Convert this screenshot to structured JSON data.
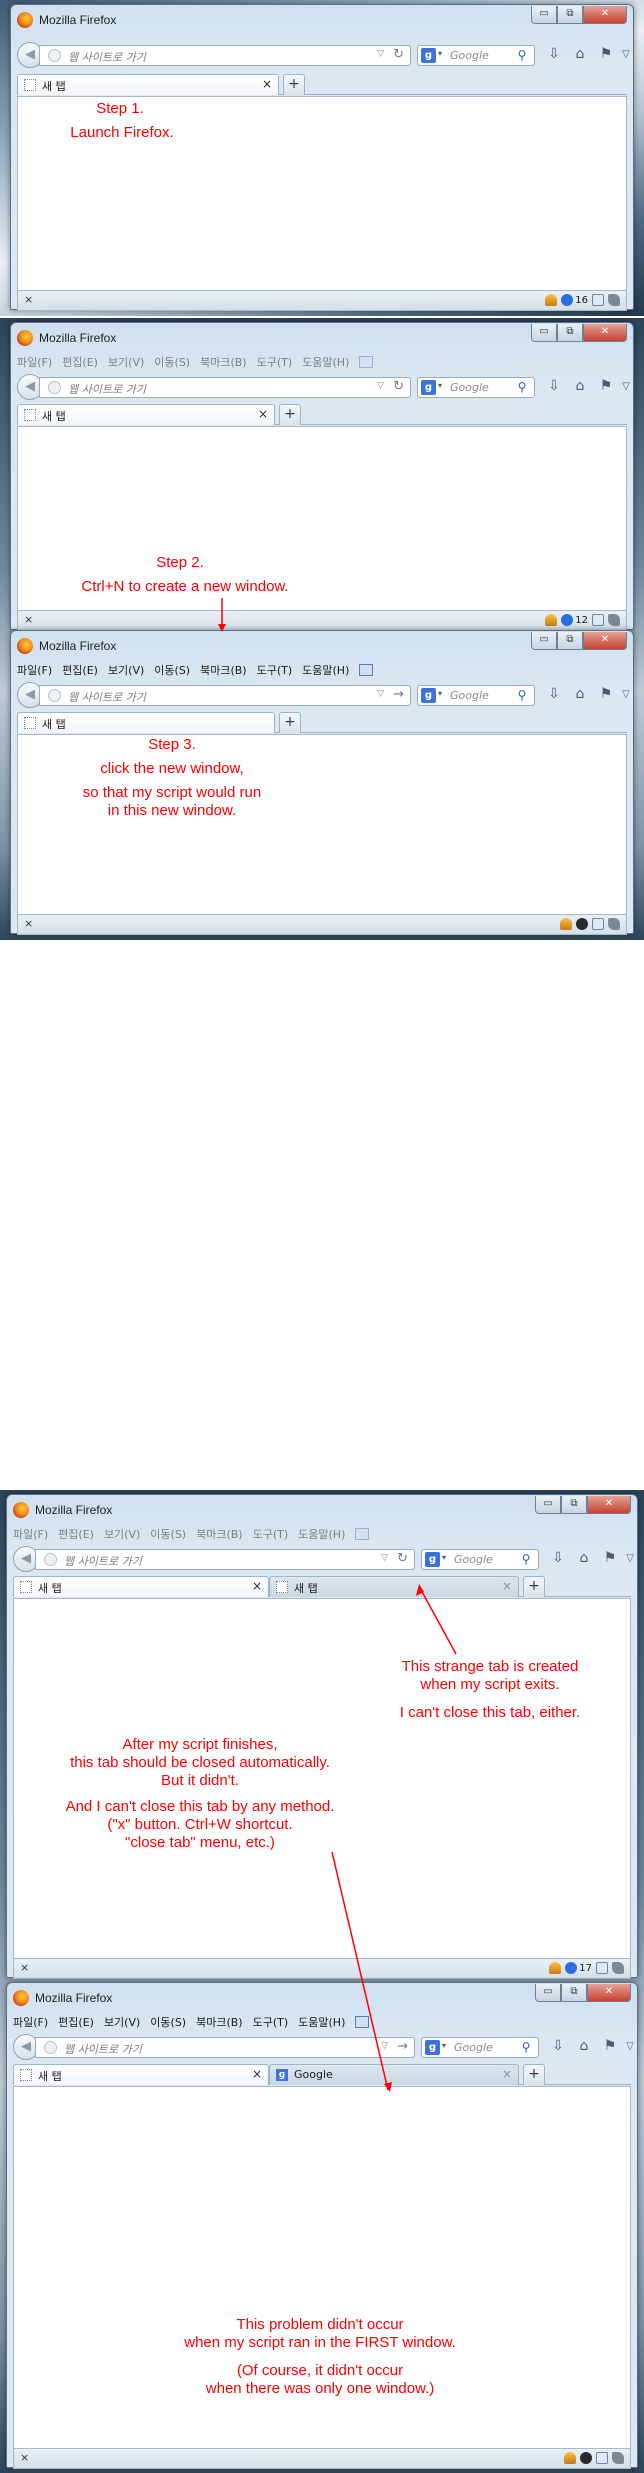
{
  "browser": {
    "title": "Mozilla Firefox",
    "window_buttons": {
      "minimize": "▭",
      "restore": "⧉",
      "close": "✕"
    },
    "menu": [
      "파일(F)",
      "편집(E)",
      "보기(V)",
      "이동(S)",
      "북마크(B)",
      "도구(T)",
      "도움말(H)"
    ],
    "url_placeholder": "웹 사이트로 가기",
    "search_placeholder": "Google",
    "search_engine_letter": "g",
    "new_tab_label": "새 탭",
    "google_tab_label": "Google",
    "tab_close": "×",
    "new_tab_button": "+",
    "status_close": "×"
  },
  "panel1": {
    "step_title": "Step 1.",
    "step_text": "Launch Firefox.",
    "status_count": "16"
  },
  "panel2": {
    "top_window": {
      "step_title": "Step 2.",
      "step_text": "Ctrl+N to create a new window.",
      "status_count": "12"
    },
    "bottom_window": {
      "step_title": "Step 3.",
      "step_lines": [
        "click the new window,",
        "so that my script would run",
        "in this new window."
      ]
    }
  },
  "panel3": {
    "top_window": {
      "status_count": "17",
      "strange_tab_notes": [
        "This strange tab is created",
        "when my script exits.",
        "I can't close this tab, either."
      ],
      "should_close_notes": [
        "After my script finishes,",
        "this tab should be closed automatically.",
        "But it didn't."
      ],
      "cannot_close_notes": [
        "And I can't close this tab by any method.",
        "(\"x\" button. Ctrl+W shortcut.",
        "\"close tab\" menu, etc.)"
      ]
    },
    "bottom_window": {
      "notes": [
        "This problem didn't occur",
        "when my script ran in the FIRST window.",
        "(Of course, it didn't occur",
        "when there was only one window.)"
      ]
    }
  },
  "colors": {
    "annotation": "#ff0000",
    "chrome_bg": "#dbe8f3",
    "accent_blue": "#3b73d9"
  },
  "icons": [
    "firefox-logo-icon",
    "back-arrow-icon",
    "globe-icon",
    "reload-icon",
    "forward-arrow-icon",
    "search-magnifier-icon",
    "download-icon",
    "home-icon",
    "bookmark-icon",
    "puzzle-icon",
    "bubble-icon",
    "flame-icon",
    "page-icon"
  ]
}
